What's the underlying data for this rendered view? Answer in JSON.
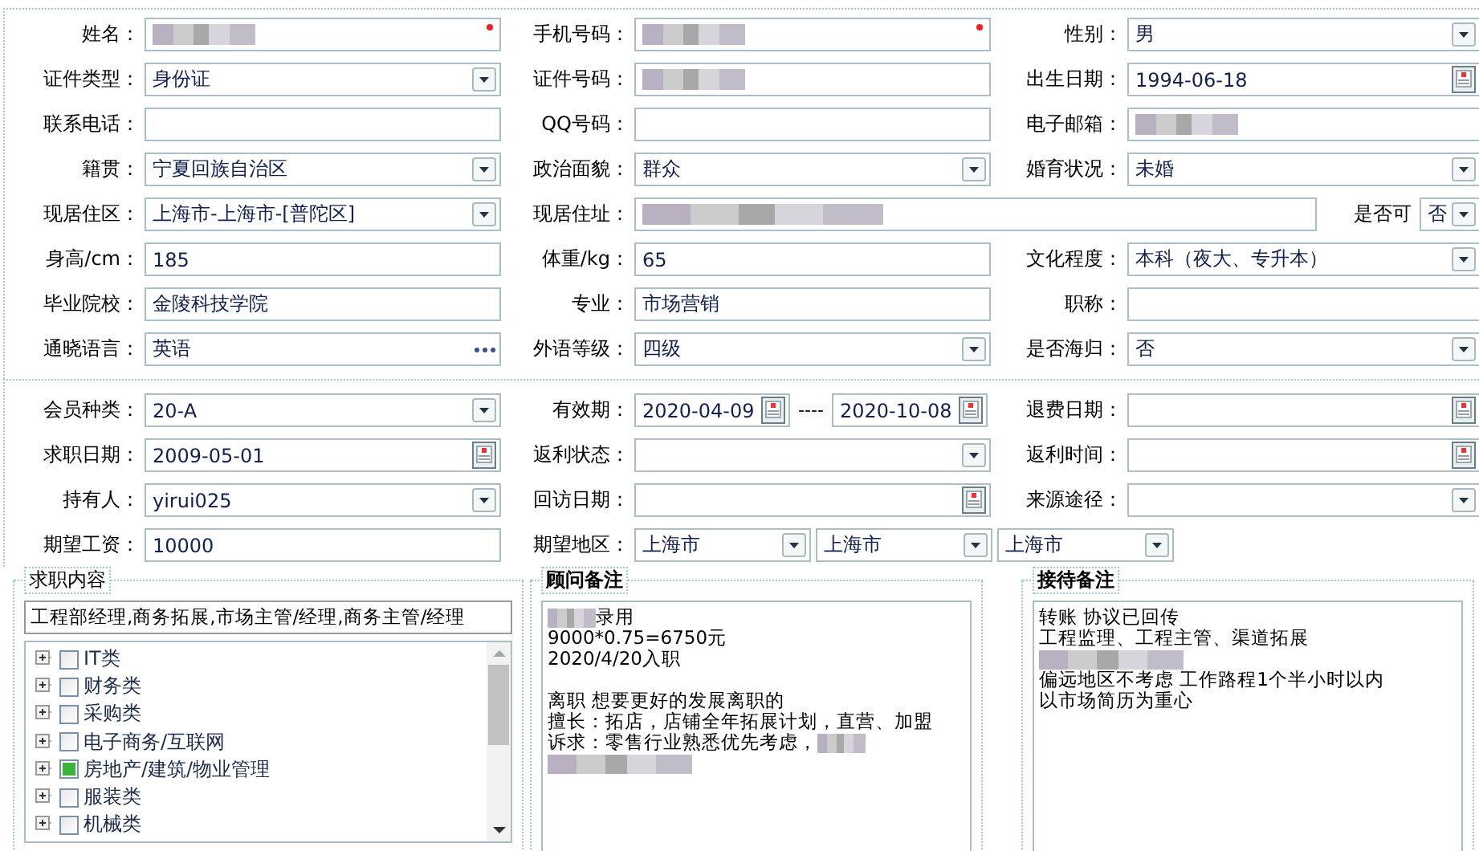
{
  "section_1": {
    "fields": [
      {
        "label": "姓名：",
        "kind": "text",
        "blurred": true,
        "required": true
      },
      {
        "label": "手机号码：",
        "kind": "text",
        "blurred": true,
        "required": true
      },
      {
        "label": "性别：",
        "kind": "select",
        "value": "男"
      },
      {
        "label": "证件类型：",
        "kind": "select",
        "value": "身份证"
      },
      {
        "label": "证件号码：",
        "kind": "text",
        "blurred": true
      },
      {
        "label": "出生日期：",
        "kind": "date",
        "value": "1994-06-18"
      },
      {
        "label": "联系电话：",
        "kind": "text"
      },
      {
        "label": "QQ号码：",
        "kind": "text"
      },
      {
        "label": "电子邮箱：",
        "kind": "text",
        "blurred": true
      },
      {
        "label": "籍贯：",
        "kind": "select",
        "value": "宁夏回族自治区"
      },
      {
        "label": "政治面貌：",
        "kind": "select",
        "value": "群众"
      },
      {
        "label": "婚育状况：",
        "kind": "select",
        "value": "未婚"
      },
      {
        "label": "现居住区：",
        "kind": "select",
        "value": "上海市-上海市-[普陀区]"
      },
      {
        "label": "现居住址：",
        "kind": "wide",
        "blurred": true,
        "suffix_label": "是否可",
        "suffix_value": "否"
      },
      {
        "label": "身高/cm：",
        "kind": "text",
        "value": "185"
      },
      {
        "label": "体重/kg：",
        "kind": "text",
        "value": "65"
      },
      {
        "label": "文化程度：",
        "kind": "select",
        "value": "本科（夜大、专升本）"
      },
      {
        "label": "毕业院校：",
        "kind": "text",
        "value": "金陵科技学院"
      },
      {
        "label": "专业：",
        "kind": "text",
        "value": "市场营销"
      },
      {
        "label": "职称：",
        "kind": "text"
      },
      {
        "label": "通晓语言：",
        "kind": "more",
        "value": "英语"
      },
      {
        "label": "外语等级：",
        "kind": "select",
        "value": "四级"
      },
      {
        "label": "是否海归：",
        "kind": "select",
        "value": "否"
      }
    ]
  },
  "section_2": {
    "fields": [
      {
        "label": "会员种类：",
        "kind": "select",
        "value": "20-A"
      },
      {
        "label": "有效期：",
        "kind": "range",
        "values": [
          "2020-04-09",
          "2020-10-08"
        ],
        "separator": "----"
      },
      {
        "label": "退费日期：",
        "kind": "date"
      },
      {
        "label": "求职日期：",
        "kind": "date",
        "value": "2009-05-01"
      },
      {
        "label": "返利状态：",
        "kind": "select"
      },
      {
        "label": "返利时间：",
        "kind": "date"
      },
      {
        "label": "持有人：",
        "kind": "select",
        "value": "yirui025"
      },
      {
        "label": "回访日期：",
        "kind": "date"
      },
      {
        "label": "来源途径：",
        "kind": "select"
      },
      {
        "label": "期望工资：",
        "kind": "text",
        "value": "10000"
      },
      {
        "label": "期望地区：",
        "kind": "multi",
        "values": [
          "上海市",
          "上海市",
          "上海市"
        ]
      }
    ]
  },
  "job_intent": {
    "title": "求职内容",
    "title_bold": false,
    "selection": "工程部经理,商务拓展,市场主管/经理,商务主管/经理",
    "tree": [
      {
        "label": "IT类",
        "checked": false
      },
      {
        "label": "财务类",
        "checked": false
      },
      {
        "label": "采购类",
        "checked": false
      },
      {
        "label": "电子商务/互联网",
        "checked": false
      },
      {
        "label": "房地产/建筑/物业管理",
        "checked": true
      },
      {
        "label": "服装类",
        "checked": false
      },
      {
        "label": "机械类",
        "checked": false
      }
    ]
  },
  "notes": [
    {
      "title": "顾问备注",
      "title_bold": true,
      "lines": [
        {
          "text": "录用",
          "blur_before": true
        },
        {
          "text": "9000*0.75=6750元"
        },
        {
          "text": "2020/4/20入职"
        },
        {
          "text": "离职 想要更好的发展离职的",
          "space_before": true
        },
        {
          "text": "擅长：拓店，店铺全年拓展计划，直营、加盟"
        },
        {
          "text": "诉求：零售行业熟悉优先考虑，",
          "blur_after": true
        },
        {
          "blurred": true
        }
      ]
    },
    {
      "title": "接待备注",
      "title_bold": true,
      "lines": [
        {
          "text": "转账  协议已回传"
        },
        {
          "text": "工程监理、工程主管、渠道拓展"
        },
        {
          "blurred": true
        },
        {
          "text": "偏远地区不考虑  工作路程1个半小时以内"
        },
        {
          "text": "以市场简历为重心"
        }
      ]
    }
  ]
}
